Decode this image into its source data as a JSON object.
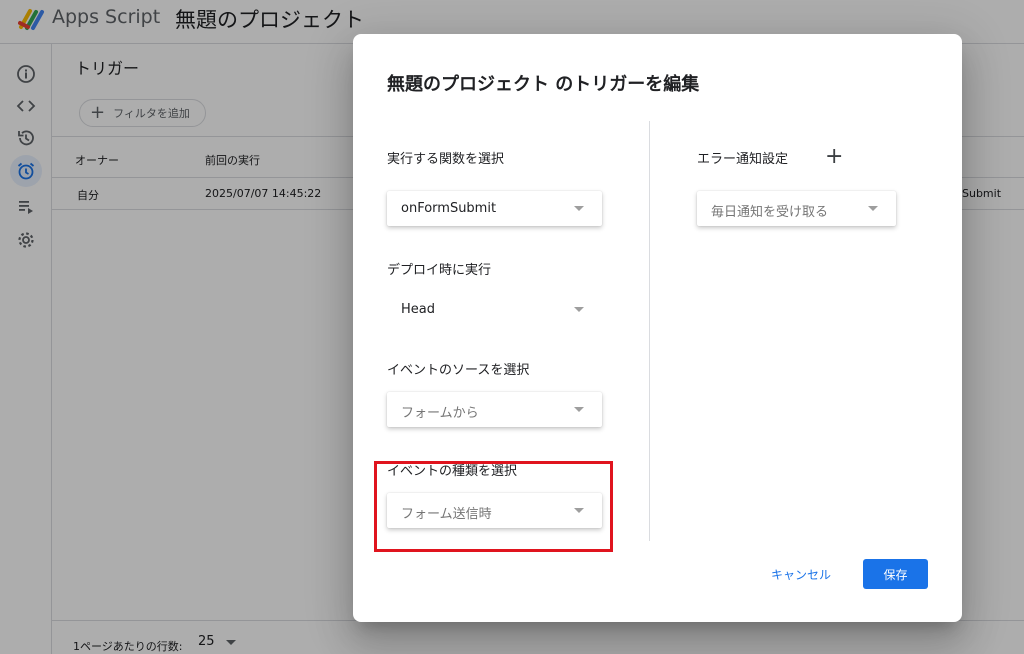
{
  "header": {
    "app_name": "Apps Script",
    "project_name": "無題のプロジェクト"
  },
  "sidebar": {
    "items": [
      {
        "icon": "info-icon"
      },
      {
        "icon": "code-icon"
      },
      {
        "icon": "history-icon"
      },
      {
        "icon": "alarm-clock-icon",
        "active": true
      },
      {
        "icon": "executions-icon"
      },
      {
        "icon": "gear-icon"
      }
    ]
  },
  "triggers_page": {
    "title": "トリガー",
    "filter_label": "フィルタを追加",
    "columns": [
      "オーナー",
      "前回の実行"
    ],
    "rows": [
      {
        "owner": "自分",
        "last_run": "2025/07/07 14:45:22",
        "function_partial": "Submit"
      }
    ],
    "rows_per_page_label": "1ページあたりの行数:",
    "rows_per_page_value": "25"
  },
  "dialog": {
    "title": "無題のプロジェクト のトリガーを編集",
    "function_label": "実行する関数を選択",
    "function_value": "onFormSubmit",
    "deployment_label": "デプロイ時に実行",
    "deployment_value": "Head",
    "event_source_label": "イベントのソースを選択",
    "event_source_value": "フォームから",
    "event_type_label": "イベントの種類を選択",
    "event_type_value": "フォーム送信時",
    "error_label": "エラー通知設定",
    "error_value": "毎日通知を受け取る",
    "cancel_label": "キャンセル",
    "save_label": "保存"
  },
  "colors": {
    "accent": "#1a73e8",
    "highlight": "#e0141e"
  }
}
